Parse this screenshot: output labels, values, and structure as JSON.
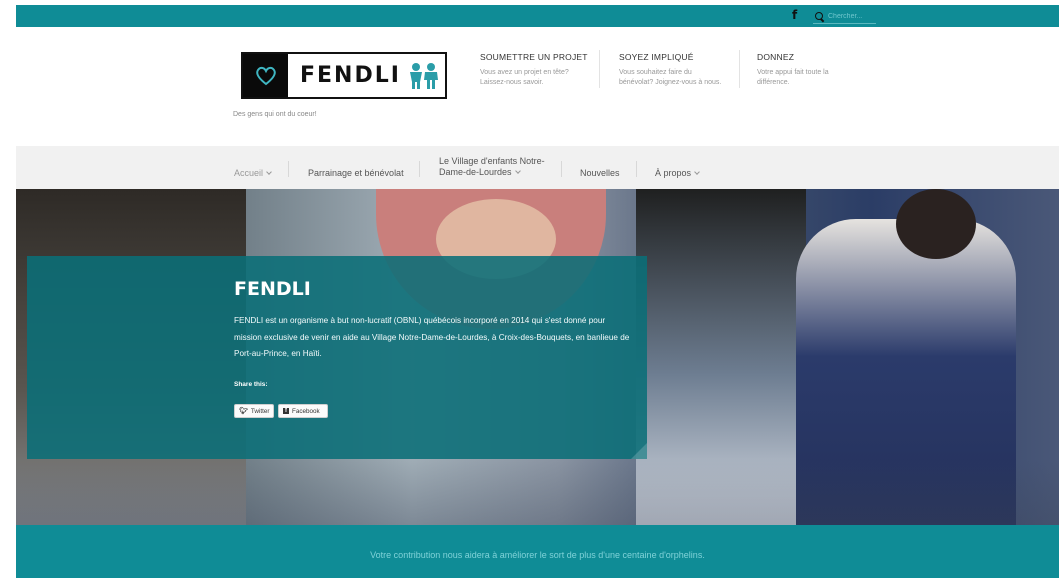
{
  "topbar": {
    "facebook_icon": "facebook-icon",
    "search_placeholder": "Chercher...",
    "color": "#0f8c96"
  },
  "brand": {
    "name": "FENDLI",
    "tagline": "Des gens qui ont du coeur!"
  },
  "cta": [
    {
      "title": "SOUMETTRE UN PROJET",
      "desc1": "Vous avez un projet en tête?",
      "desc2": "Laissez-nous savoir."
    },
    {
      "title": "SOYEZ IMPLIQUÉ",
      "desc1": "Vous souhaitez faire du",
      "desc2": "bénévolat? Joignez-vous à nous."
    },
    {
      "title": "DONNEZ",
      "desc1": "Votre appui fait toute la",
      "desc2": "différence."
    }
  ],
  "nav": {
    "items": [
      {
        "label": "Accueil"
      },
      {
        "label": "Parrainage et bénévolat"
      },
      {
        "label1": "Le Village d'enfants Notre-",
        "label2": "Dame-de-Lourdes"
      },
      {
        "label": "Nouvelles"
      },
      {
        "label": "À propos"
      }
    ]
  },
  "hero": {
    "title": "FENDLI",
    "description": "FENDLI est un organisme à but non-lucratif (OBNL) québécois incorporé en 2014 qui s'est donné pour mission exclusive de venir en aide au Village Notre-Dame-de-Lourdes, à Croix-des-Bouquets, en banlieue de Port-au-Prince, en Haïti.",
    "share_label": "Share this:",
    "twitter_label": "Twitter",
    "facebook_label": "Facebook"
  },
  "footer": {
    "message": "Votre contribution nous aidera à améliorer le sort de plus d'une centaine d'orphelins."
  }
}
